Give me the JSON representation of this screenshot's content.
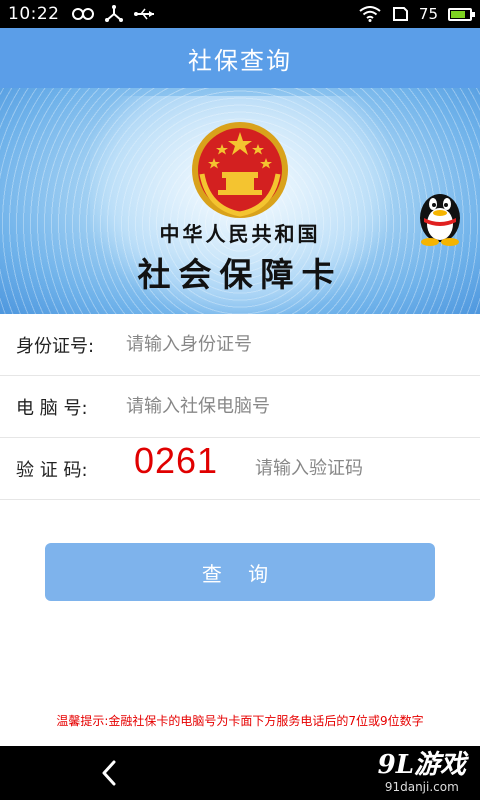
{
  "status_bar": {
    "time": "10:22",
    "battery_level": "75",
    "battery_fraction": 0.75,
    "icons": [
      "infinity-icon",
      "usb-icon",
      "usb-debug-icon",
      "wifi-icon",
      "sim-icon",
      "battery-icon"
    ]
  },
  "header": {
    "title": "社保查询"
  },
  "banner": {
    "country": "中华人民共和国",
    "card_name": "社会保障卡",
    "emblem": "national-emblem-icon",
    "mascot": "qq-penguin-icon"
  },
  "form": {
    "id_label": "身份证号:",
    "id_placeholder": "请输入身份证号",
    "pc_label": "电 脑 号:",
    "pc_placeholder": "请输入社保电脑号",
    "code_label": "验 证 码:",
    "captcha_value": "0261",
    "code_placeholder": "请输入验证码"
  },
  "actions": {
    "query_label": "查 询"
  },
  "tip": "温馨提示:金融社保卡的电脑号为卡面下方服务电话后的7位或9位数字",
  "nav_bar": {
    "back": "back-icon",
    "watermark_logo": "9L游戏",
    "watermark_url": "91danji.com"
  },
  "colors": {
    "accent": "#5b9ee8",
    "button": "#7eb3ec",
    "tip": "#e60000",
    "captcha": "#e00000"
  }
}
